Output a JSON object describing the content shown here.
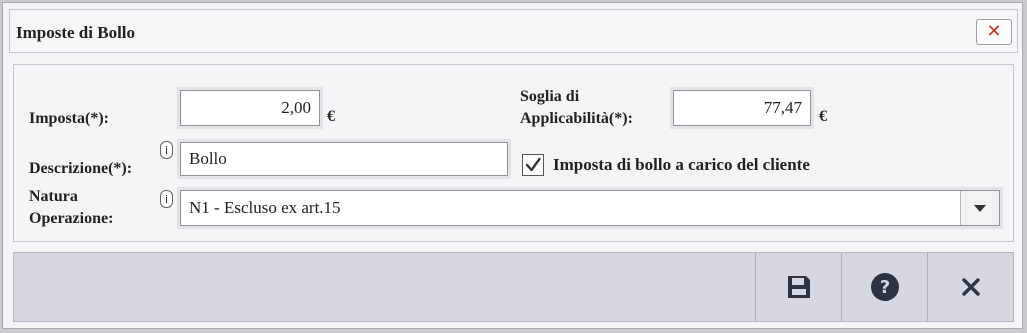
{
  "window": {
    "title": "Imposte di Bollo",
    "close_glyph": "✕"
  },
  "form": {
    "imposta": {
      "label": "Imposta(*):",
      "value": "2,00",
      "currency": "€"
    },
    "soglia": {
      "label_line1": "Soglia di",
      "label_line2": "Applicabilità(*):",
      "value": "77,47",
      "currency": "€"
    },
    "descrizione": {
      "label": "Descrizione(*):",
      "value": "Bollo",
      "info_glyph": "i"
    },
    "carico_cliente": {
      "label": "Imposta di bollo a carico del cliente",
      "checked": true
    },
    "natura": {
      "label_line1": "Natura",
      "label_line2": "Operazione:",
      "value": "N1 - Escluso ex art.15",
      "info_glyph": "i"
    }
  },
  "toolbar": {
    "buttons": [
      {
        "icon": "save-icon"
      },
      {
        "icon": "help-icon"
      },
      {
        "icon": "close-icon"
      }
    ]
  },
  "colors": {
    "close_red": "#c0392b",
    "icon_dark": "#2b3440",
    "toolbar_bg": "#d4d8e0"
  }
}
